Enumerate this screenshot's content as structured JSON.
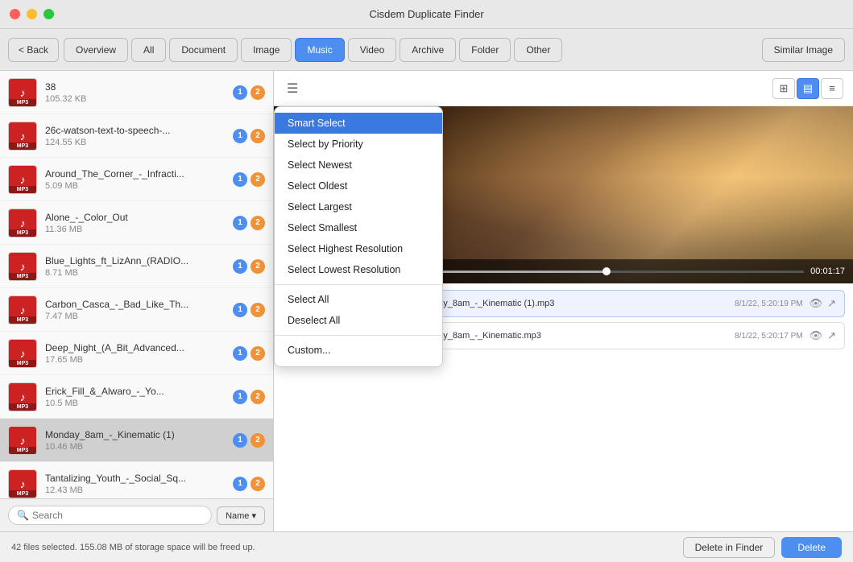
{
  "window": {
    "title": "Cisdem Duplicate Finder"
  },
  "toolbar": {
    "back_label": "< Back",
    "tabs": [
      {
        "id": "overview",
        "label": "Overview",
        "active": false
      },
      {
        "id": "all",
        "label": "All",
        "active": false
      },
      {
        "id": "document",
        "label": "Document",
        "active": false
      },
      {
        "id": "image",
        "label": "Image",
        "active": false
      },
      {
        "id": "music",
        "label": "Music",
        "active": true
      },
      {
        "id": "video",
        "label": "Video",
        "active": false
      },
      {
        "id": "archive",
        "label": "Archive",
        "active": false
      },
      {
        "id": "folder",
        "label": "Folder",
        "active": false
      },
      {
        "id": "other",
        "label": "Other",
        "active": false
      }
    ],
    "similar_image_label": "Similar Image"
  },
  "right_toolbar": {
    "menu_icon": "☰"
  },
  "dropdown": {
    "items_group1": [
      {
        "id": "smart-select",
        "label": "Smart Select",
        "highlighted": true
      },
      {
        "id": "select-by-priority",
        "label": "Select by Priority",
        "highlighted": false
      },
      {
        "id": "select-newest",
        "label": "Select Newest",
        "highlighted": false
      },
      {
        "id": "select-oldest",
        "label": "Select Oldest",
        "highlighted": false
      },
      {
        "id": "select-largest",
        "label": "Select Largest",
        "highlighted": false
      },
      {
        "id": "select-smallest",
        "label": "Select Smallest",
        "highlighted": false
      },
      {
        "id": "select-highest-resolution",
        "label": "Select Highest Resolution",
        "highlighted": false
      },
      {
        "id": "select-lowest-resolution",
        "label": "Select Lowest Resolution",
        "highlighted": false
      }
    ],
    "items_group2": [
      {
        "id": "select-all",
        "label": "Select All",
        "highlighted": false
      },
      {
        "id": "deselect-all",
        "label": "Deselect All",
        "highlighted": false
      }
    ],
    "items_group3": [
      {
        "id": "custom",
        "label": "Custom...",
        "highlighted": false
      }
    ]
  },
  "file_list": [
    {
      "name": "38",
      "size": "105.32 KB",
      "badge1": "1",
      "badge2": "2",
      "selected": false
    },
    {
      "name": "26c-watson-text-to-speech-...",
      "size": "124.55 KB",
      "badge1": "1",
      "badge2": "2",
      "selected": false
    },
    {
      "name": "Around_The_Corner_-_Infracti...",
      "size": "5.09 MB",
      "badge1": "1",
      "badge2": "2",
      "selected": false
    },
    {
      "name": "Alone_-_Color_Out",
      "size": "11.36 MB",
      "badge1": "1",
      "badge2": "2",
      "selected": false
    },
    {
      "name": "Blue_Lights_ft_LizAnn_(RADIO...",
      "size": "8.71 MB",
      "badge1": "1",
      "badge2": "2",
      "selected": false
    },
    {
      "name": "Carbon_Casca_-_Bad_Like_Th...",
      "size": "7.47 MB",
      "badge1": "1",
      "badge2": "2",
      "selected": false
    },
    {
      "name": "Deep_Night_(A_Bit_Advanced...",
      "size": "17.65 MB",
      "badge1": "1",
      "badge2": "2",
      "selected": false
    },
    {
      "name": "Erick_Fill_&amp;_Alwaro_-_Yo...",
      "size": "10.5 MB",
      "badge1": "1",
      "badge2": "2",
      "selected": false
    },
    {
      "name": "Monday_8am_-_Kinematic (1)",
      "size": "10.46 MB",
      "badge1": "1",
      "badge2": "2",
      "selected": true
    },
    {
      "name": "Tantalizing_Youth_-_Social_Sq...",
      "size": "12.43 MB",
      "badge1": "1",
      "badge2": "2",
      "selected": false
    }
  ],
  "search": {
    "placeholder": "Search",
    "label": "search"
  },
  "sort_btn": "Name ▾",
  "video": {
    "time": "00:01:17"
  },
  "file_entries": [
    {
      "checked": true,
      "path": "/Users/mac/Desktop/dupe/Monday_8am_-_Kinematic (1).mp3",
      "date": "8/1/22, 5:20:19 PM"
    },
    {
      "checked": false,
      "path": "/Users/mac/Desktop/dupe/Monday_8am_-_Kinematic.mp3",
      "date": "8/1/22, 5:20:17 PM"
    }
  ],
  "status_bar": {
    "text": "42 files selected.  155.08 MB of storage space will be freed up.",
    "delete_finder_label": "Delete in Finder",
    "delete_label": "Delete"
  },
  "view_icons": [
    "⊞",
    "▤",
    "≡"
  ]
}
